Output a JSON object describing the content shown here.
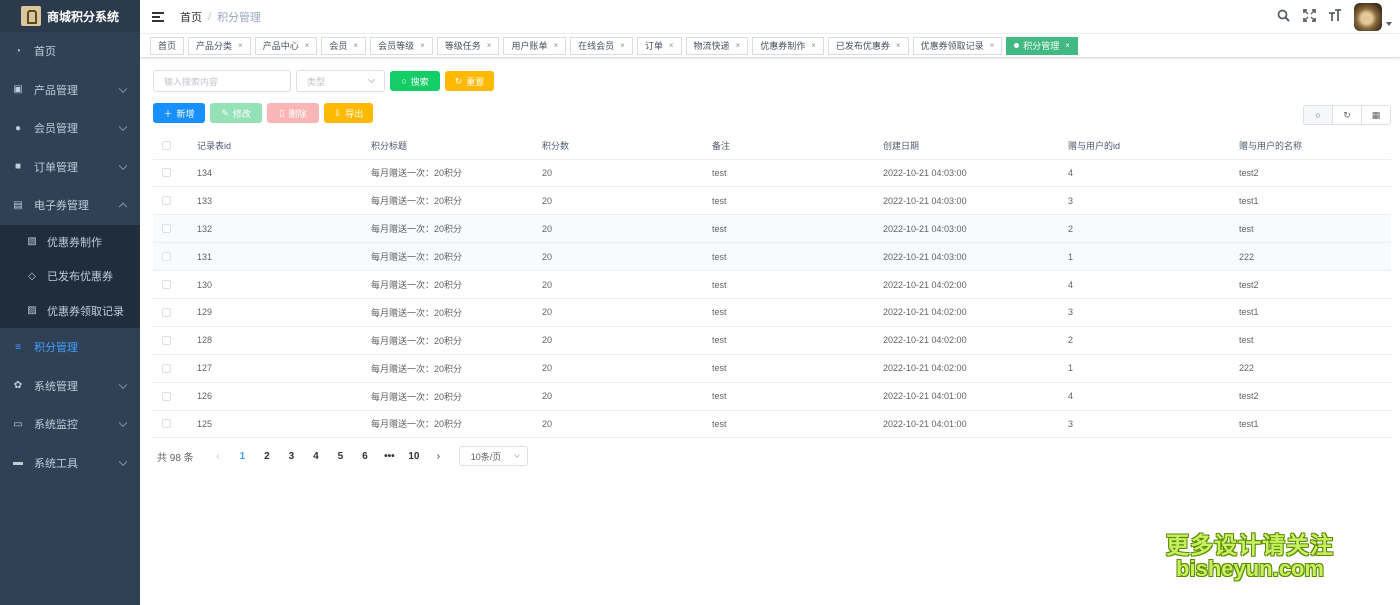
{
  "app": {
    "title": "商城积分系统"
  },
  "sidebar": {
    "items": [
      {
        "label": "首页",
        "icon": "dashboard-icon",
        "glyph": "◔",
        "chev": false
      },
      {
        "label": "产品管理",
        "icon": "product-icon",
        "glyph": "▣",
        "chev": true
      },
      {
        "label": "会员管理",
        "icon": "user-icon",
        "glyph": "●",
        "chev": true
      },
      {
        "label": "订单管理",
        "icon": "lock-icon",
        "glyph": "■",
        "chev": true
      },
      {
        "label": "电子券管理",
        "icon": "coupon-icon",
        "glyph": "▤",
        "chev": true,
        "open": true
      }
    ],
    "submenu": [
      {
        "label": "优惠券制作",
        "icon": "coupon-edit-icon",
        "glyph": "▧"
      },
      {
        "label": "已发布优惠券",
        "icon": "tag-icon",
        "glyph": "◇"
      },
      {
        "label": "优惠券领取记录",
        "icon": "record-icon",
        "glyph": "▨"
      }
    ],
    "items2": [
      {
        "label": "积分管理",
        "icon": "points-icon",
        "glyph": "≡",
        "chev": false,
        "active": true
      },
      {
        "label": "系统管理",
        "icon": "system-icon",
        "glyph": "✿",
        "chev": true
      },
      {
        "label": "系统监控",
        "icon": "monitor-icon",
        "glyph": "▭",
        "chev": true
      },
      {
        "label": "系统工具",
        "icon": "toolbox-icon",
        "glyph": "▬",
        "chev": true
      }
    ]
  },
  "breadcrumb": {
    "home": "首页",
    "sep": "/",
    "current": "积分管理"
  },
  "tags": [
    {
      "label": "首页",
      "closable": false
    },
    {
      "label": "产品分类",
      "closable": true
    },
    {
      "label": "产品中心",
      "closable": true
    },
    {
      "label": "会员",
      "closable": true
    },
    {
      "label": "会员等级",
      "closable": true
    },
    {
      "label": "等级任务",
      "closable": true
    },
    {
      "label": "用户账单",
      "closable": true
    },
    {
      "label": "在线会员",
      "closable": true
    },
    {
      "label": "订单",
      "closable": true
    },
    {
      "label": "物流快递",
      "closable": true
    },
    {
      "label": "优惠券制作",
      "closable": true
    },
    {
      "label": "已发布优惠券",
      "closable": true
    },
    {
      "label": "优惠券领取记录",
      "closable": true
    },
    {
      "label": "积分管理",
      "closable": true,
      "active": true
    }
  ],
  "search": {
    "input_placeholder": "输入搜索内容",
    "type_placeholder": "类型",
    "search_btn": "搜索",
    "reset_btn": "重置"
  },
  "toolbar": {
    "add": "新增",
    "edit": "修改",
    "delete": "删除",
    "export": "导出"
  },
  "table": {
    "columns": [
      "记录表id",
      "积分标题",
      "积分数",
      "备注",
      "创建日期",
      "赠与用户的id",
      "赠与用户的名称"
    ],
    "rows": [
      [
        "134",
        "每月赠送一次：20积分",
        "20",
        "test",
        "2022-10-21 04:03:00",
        "4",
        "test2"
      ],
      [
        "133",
        "每月赠送一次：20积分",
        "20",
        "test",
        "2022-10-21 04:03:00",
        "3",
        "test1"
      ],
      [
        "132",
        "每月赠送一次：20积分",
        "20",
        "test",
        "2022-10-21 04:03:00",
        "2",
        "test"
      ],
      [
        "131",
        "每月赠送一次：20积分",
        "20",
        "test",
        "2022-10-21 04:03:00",
        "1",
        "222"
      ],
      [
        "130",
        "每月赠送一次：20积分",
        "20",
        "test",
        "2022-10-21 04:02:00",
        "4",
        "test2"
      ],
      [
        "129",
        "每月赠送一次：20积分",
        "20",
        "test",
        "2022-10-21 04:02:00",
        "3",
        "test1"
      ],
      [
        "128",
        "每月赠送一次：20积分",
        "20",
        "test",
        "2022-10-21 04:02:00",
        "2",
        "test"
      ],
      [
        "127",
        "每月赠送一次：20积分",
        "20",
        "test",
        "2022-10-21 04:02:00",
        "1",
        "222"
      ],
      [
        "126",
        "每月赠送一次：20积分",
        "20",
        "test",
        "2022-10-21 04:01:00",
        "4",
        "test2"
      ],
      [
        "125",
        "每月赠送一次：20积分",
        "20",
        "test",
        "2022-10-21 04:01:00",
        "3",
        "test1"
      ]
    ]
  },
  "pagination": {
    "total": "共 98 条",
    "pages": [
      "1",
      "2",
      "3",
      "4",
      "5",
      "6",
      "•••",
      "10"
    ],
    "current": "1",
    "page_size": "10条/页"
  },
  "watermark": {
    "line1": "更多设计请关注",
    "line2": "bisheyun.com"
  },
  "colors": {
    "sidebar": "#304156",
    "accent": "#409eff",
    "active_tag": "#42b983"
  }
}
